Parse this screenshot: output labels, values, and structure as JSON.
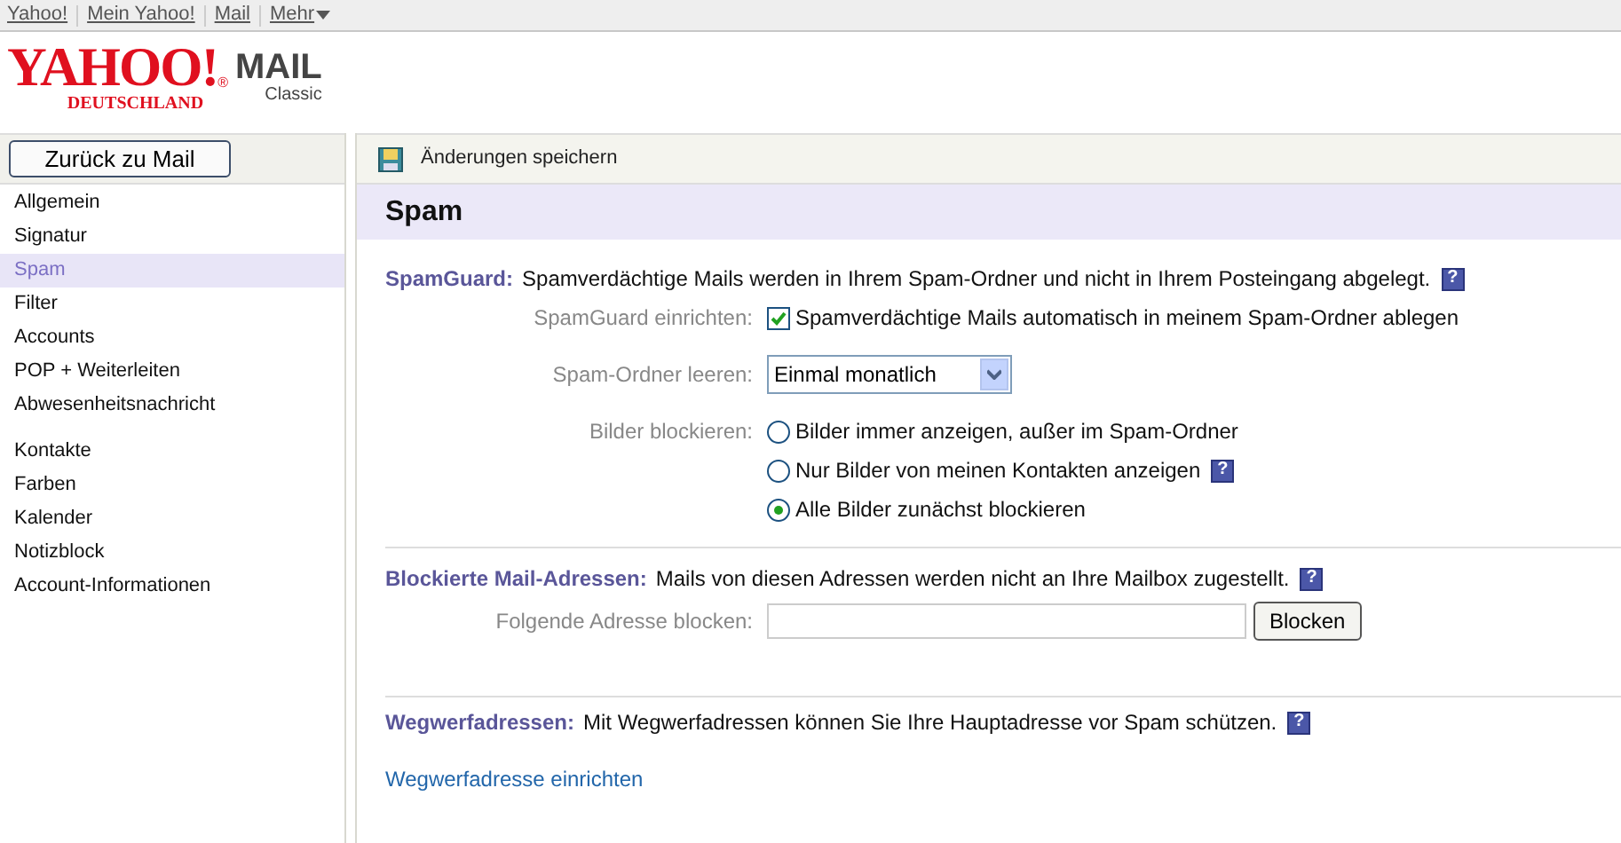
{
  "top_links": [
    "Yahoo!",
    "Mein Yahoo!",
    "Mail",
    "Mehr"
  ],
  "logo": {
    "brand": "YAHOO!",
    "reg": "®",
    "region": "DEUTSCHLAND",
    "product": "MAIL",
    "edition": "Classic"
  },
  "back_button": "Zurück zu Mail",
  "sidebar": {
    "groups": [
      {
        "items": [
          {
            "label": "Allgemein",
            "selected": false
          },
          {
            "label": "Signatur",
            "selected": false
          },
          {
            "label": "Spam",
            "selected": true
          },
          {
            "label": "Filter",
            "selected": false
          },
          {
            "label": "Accounts",
            "selected": false
          },
          {
            "label": "POP + Weiterleiten",
            "selected": false
          },
          {
            "label": "Abwesenheitsnachricht",
            "selected": false
          }
        ]
      },
      {
        "items": [
          {
            "label": "Kontakte",
            "selected": false
          },
          {
            "label": "Farben",
            "selected": false
          },
          {
            "label": "Kalender",
            "selected": false
          },
          {
            "label": "Notizblock",
            "selected": false
          },
          {
            "label": "Account-Informationen",
            "selected": false
          }
        ]
      }
    ]
  },
  "toolbar": {
    "save": "Änderungen speichern"
  },
  "page_title": "Spam",
  "sections": [
    {
      "heading": "SpamGuard:",
      "description": "Spamverdächtige Mails werden in Ihrem Spam-Ordner und nicht in Ihrem Posteingang abgelegt.",
      "help": "?",
      "rows": [
        {
          "kind": "checkbox",
          "label": "SpamGuard einrichten:",
          "text": "Spamverdächtige Mails automatisch in meinem Spam-Ordner ablegen",
          "checked": true
        },
        {
          "kind": "select",
          "label": "Spam-Ordner leeren:",
          "value": "Einmal monatlich"
        },
        {
          "kind": "radio",
          "label": "Bilder blockieren:",
          "options": [
            {
              "text": "Bilder immer anzeigen, außer im Spam-Ordner",
              "selected": false
            },
            {
              "text": "Nur Bilder von meinen Kontakten anzeigen",
              "selected": false,
              "help": "?"
            },
            {
              "text": "Alle Bilder zunächst blockieren",
              "selected": true
            }
          ]
        }
      ]
    },
    {
      "heading": "Blockierte Mail-Adressen:",
      "description": "Mails von diesen Adressen werden nicht an Ihre Mailbox zugestellt.",
      "help": "?",
      "rows": [
        {
          "kind": "input",
          "label": "Folgende Adresse blocken:",
          "button": "Blocken"
        }
      ]
    },
    {
      "heading": "Wegwerfadressen:",
      "description": "Mit Wegwerfadressen können Sie Ihre Hauptadresse vor Spam schützen.",
      "help": "?",
      "link": "Wegwerfadresse einrichten"
    }
  ]
}
